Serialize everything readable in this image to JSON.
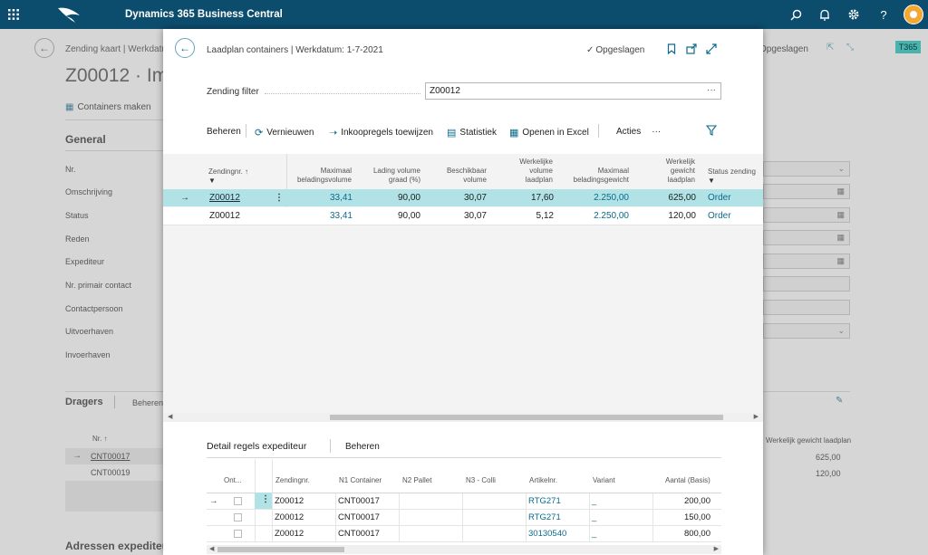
{
  "app": {
    "title": "Dynamics 365 Business Central",
    "tenant": "T365"
  },
  "icons": {
    "waffle": "waffle-icon",
    "search": "search-icon",
    "bell": "bell-icon",
    "gear": "gear-icon",
    "help": "help-icon",
    "back": "back-arrow-icon"
  },
  "bg": {
    "breadcrumb": "Zending kaart | Werkdatum",
    "title": "Z00012 · Imp",
    "saved": "Opgeslagen",
    "action": "Containers maken",
    "section": "General",
    "fields": [
      "Nr.",
      "Omschrijving",
      "Status",
      "Reden",
      "Expediteur",
      "Nr. primair contact",
      "Contactpersoon",
      "Uitvoerhaven",
      "Invoerhaven"
    ],
    "dragers": "Dragers",
    "dragers_action": "Beheren",
    "dragers_col": "Nr. ↑",
    "dragers_rows": [
      "CNT00017",
      "CNT00019"
    ],
    "right_col": "Werkelijk gewicht laadplan",
    "right_vals": [
      "625,00",
      "120,00"
    ],
    "adressen": "Adressen expediteu"
  },
  "modal": {
    "title": "Laadplan containers | Werkdatum: 1-7-2021",
    "saved": "Opgeslagen",
    "filter_label": "Zending filter",
    "filter_value": "Z00012",
    "toolbar": [
      "Beheren",
      "Vernieuwen",
      "Inkoopregels toewijzen",
      "Statistiek",
      "Openen in Excel",
      "Acties"
    ],
    "columns": [
      "Zendingnr. ↑",
      "Maximaal beladingsvolume",
      "Lading volume graad (%)",
      "Beschikbaar volume",
      "Werkelijke volume laadplan",
      "Maximaal beladingsgewicht",
      "Werkelijk gewicht laadplan",
      "Status zending"
    ],
    "rows": [
      {
        "nr": "Z00012",
        "max_vol": "33,41",
        "graad": "90,00",
        "besch": "30,07",
        "werk_vol": "17,60",
        "max_gew": "2.250,00",
        "werk_gew": "625,00",
        "status": "Order"
      },
      {
        "nr": "Z00012",
        "max_vol": "33,41",
        "graad": "90,00",
        "besch": "30,07",
        "werk_vol": "5,12",
        "max_gew": "2.250,00",
        "werk_gew": "120,00",
        "status": "Order"
      }
    ],
    "detail_title": "Detail regels expediteur",
    "detail_action": "Beheren",
    "detail_columns": [
      "Ont...",
      "Zendingnr.",
      "N1 Container",
      "N2 Pallet",
      "N3 - Colli",
      "Artikelnr.",
      "Variant",
      "Aantal (Basis)"
    ],
    "detail_rows": [
      {
        "zending": "Z00012",
        "n1": "CNT00017",
        "art": "RTG271",
        "variant": "_",
        "aantal": "200,00"
      },
      {
        "zending": "Z00012",
        "n1": "CNT00017",
        "art": "RTG271",
        "variant": "_",
        "aantal": "150,00"
      },
      {
        "zending": "Z00012",
        "n1": "CNT00017",
        "art": "30130540",
        "variant": "_",
        "aantal": "800,00"
      }
    ]
  }
}
